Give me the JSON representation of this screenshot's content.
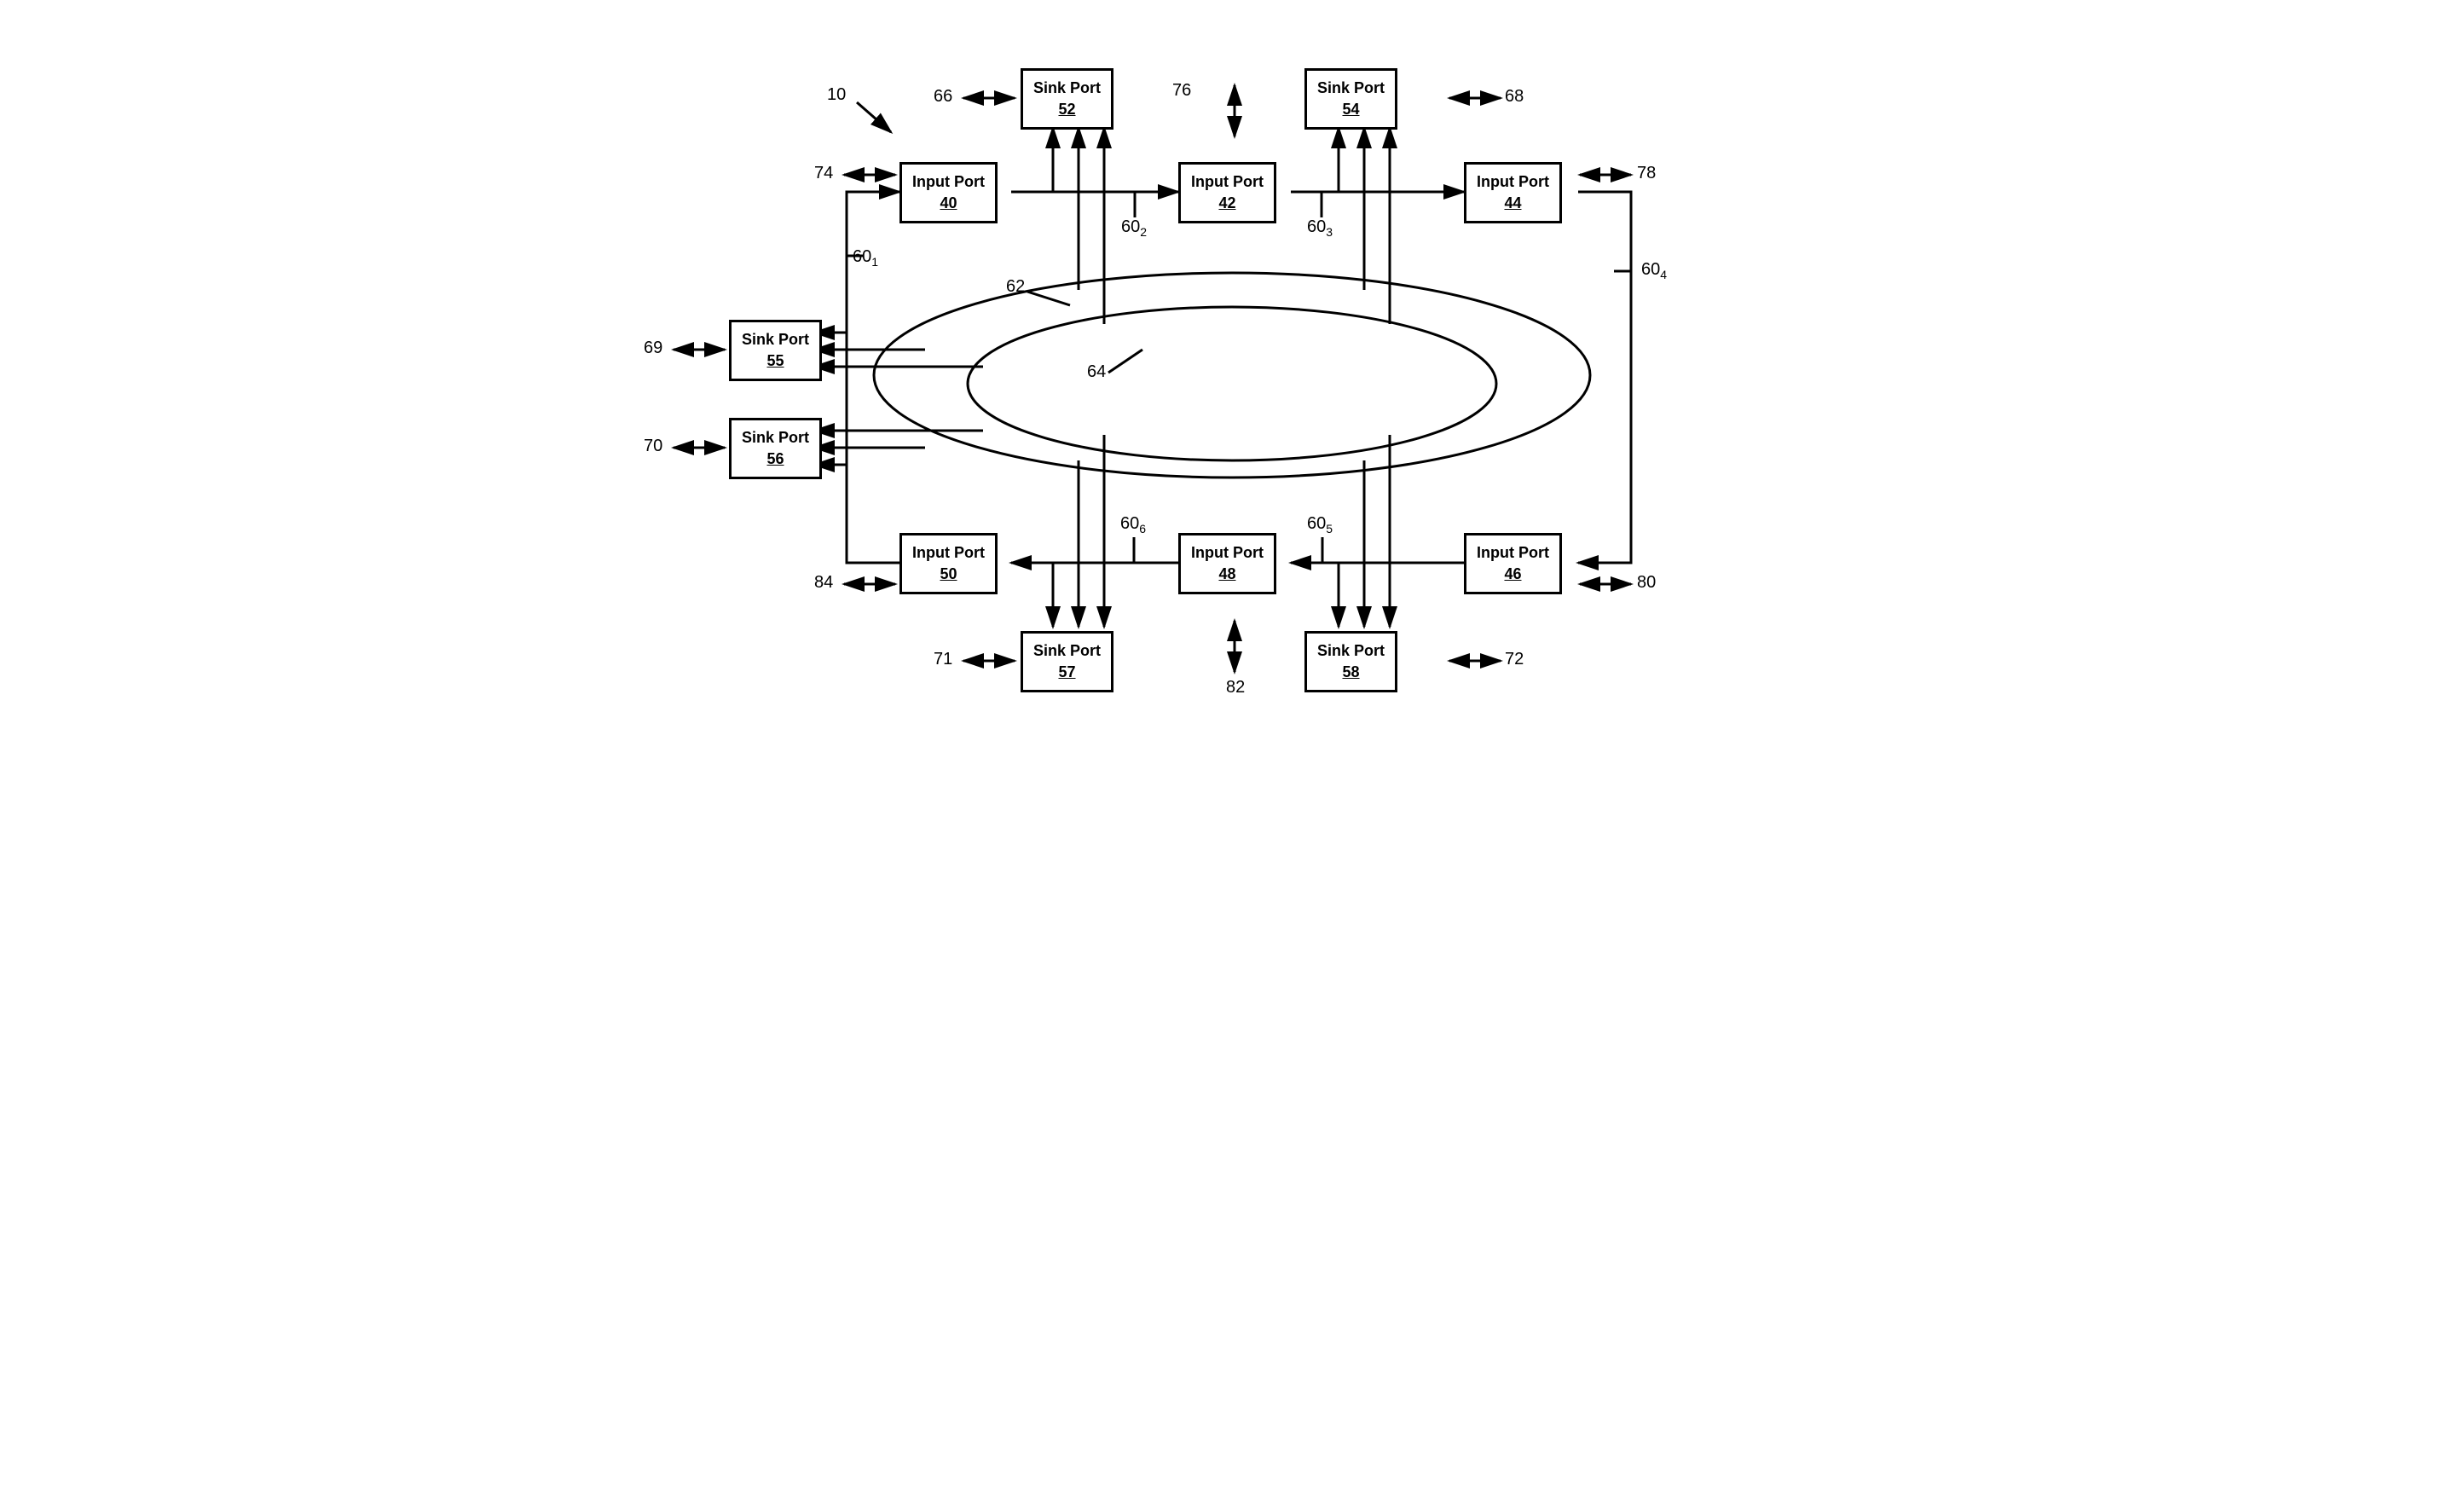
{
  "boxes": {
    "sink52": {
      "label": "Sink Port",
      "num": "52"
    },
    "sink54": {
      "label": "Sink Port",
      "num": "54"
    },
    "input40": {
      "label": "Input Port",
      "num": "40"
    },
    "input42": {
      "label": "Input Port",
      "num": "42"
    },
    "input44": {
      "label": "Input Port",
      "num": "44"
    },
    "sink55": {
      "label": "Sink Port",
      "num": "55"
    },
    "sink56": {
      "label": "Sink Port",
      "num": "56"
    },
    "input50": {
      "label": "Input Port",
      "num": "50"
    },
    "input48": {
      "label": "Input Port",
      "num": "48"
    },
    "input46": {
      "label": "Input Port",
      "num": "46"
    },
    "sink57": {
      "label": "Sink Port",
      "num": "57"
    },
    "sink58": {
      "label": "Sink Port",
      "num": "58"
    }
  },
  "refs": {
    "r10": "10",
    "r66": "66",
    "r76": "76",
    "r68": "68",
    "r74": "74",
    "r78": "78",
    "r601": "60",
    "r602": "60",
    "r603": "60",
    "r604": "60",
    "r605": "60",
    "r606": "60",
    "r62": "62",
    "r64": "64",
    "r69": "69",
    "r70": "70",
    "r84": "84",
    "r80": "80",
    "r71": "71",
    "r82": "82",
    "r72": "72"
  },
  "subs": {
    "s1": "1",
    "s2": "2",
    "s3": "3",
    "s4": "4",
    "s5": "5",
    "s6": "6"
  }
}
